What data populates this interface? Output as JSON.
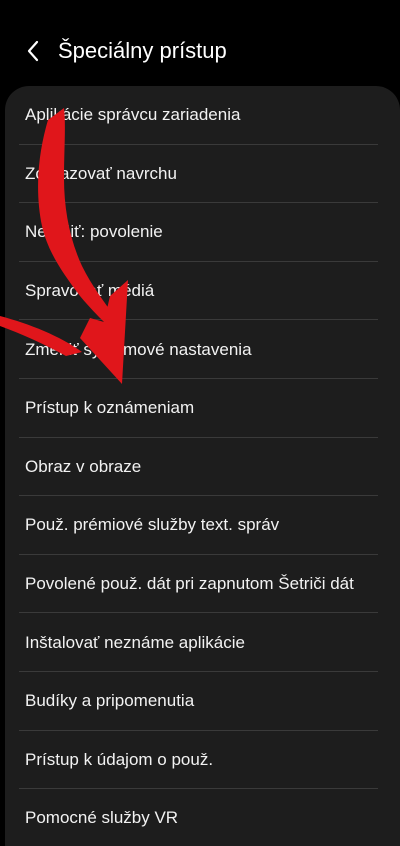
{
  "header": {
    "back_icon": "chevron-left-icon",
    "title": "Špeciálny prístup"
  },
  "items": [
    {
      "label": "Aplikácie správcu zariadenia"
    },
    {
      "label": "Zobrazovať navrchu"
    },
    {
      "label": "Nerušiť: povolenie"
    },
    {
      "label": "Spravovať médiá"
    },
    {
      "label": "Zmeniť systémové nastavenia"
    },
    {
      "label": "Prístup k oznámeniam"
    },
    {
      "label": "Obraz v obraze"
    },
    {
      "label": "Použ. prémiové služby text. správ"
    },
    {
      "label": "Povolené použ. dát pri zapnutom Šetriči dát"
    },
    {
      "label": "Inštalovať neznáme aplikácie"
    },
    {
      "label": "Budíky a pripomenutia"
    },
    {
      "label": "Prístup k údajom o použ."
    },
    {
      "label": "Pomocné služby VR"
    }
  ],
  "overlay": {
    "annotation_icon": "curved-arrow-icon",
    "color": "#e0161b"
  }
}
